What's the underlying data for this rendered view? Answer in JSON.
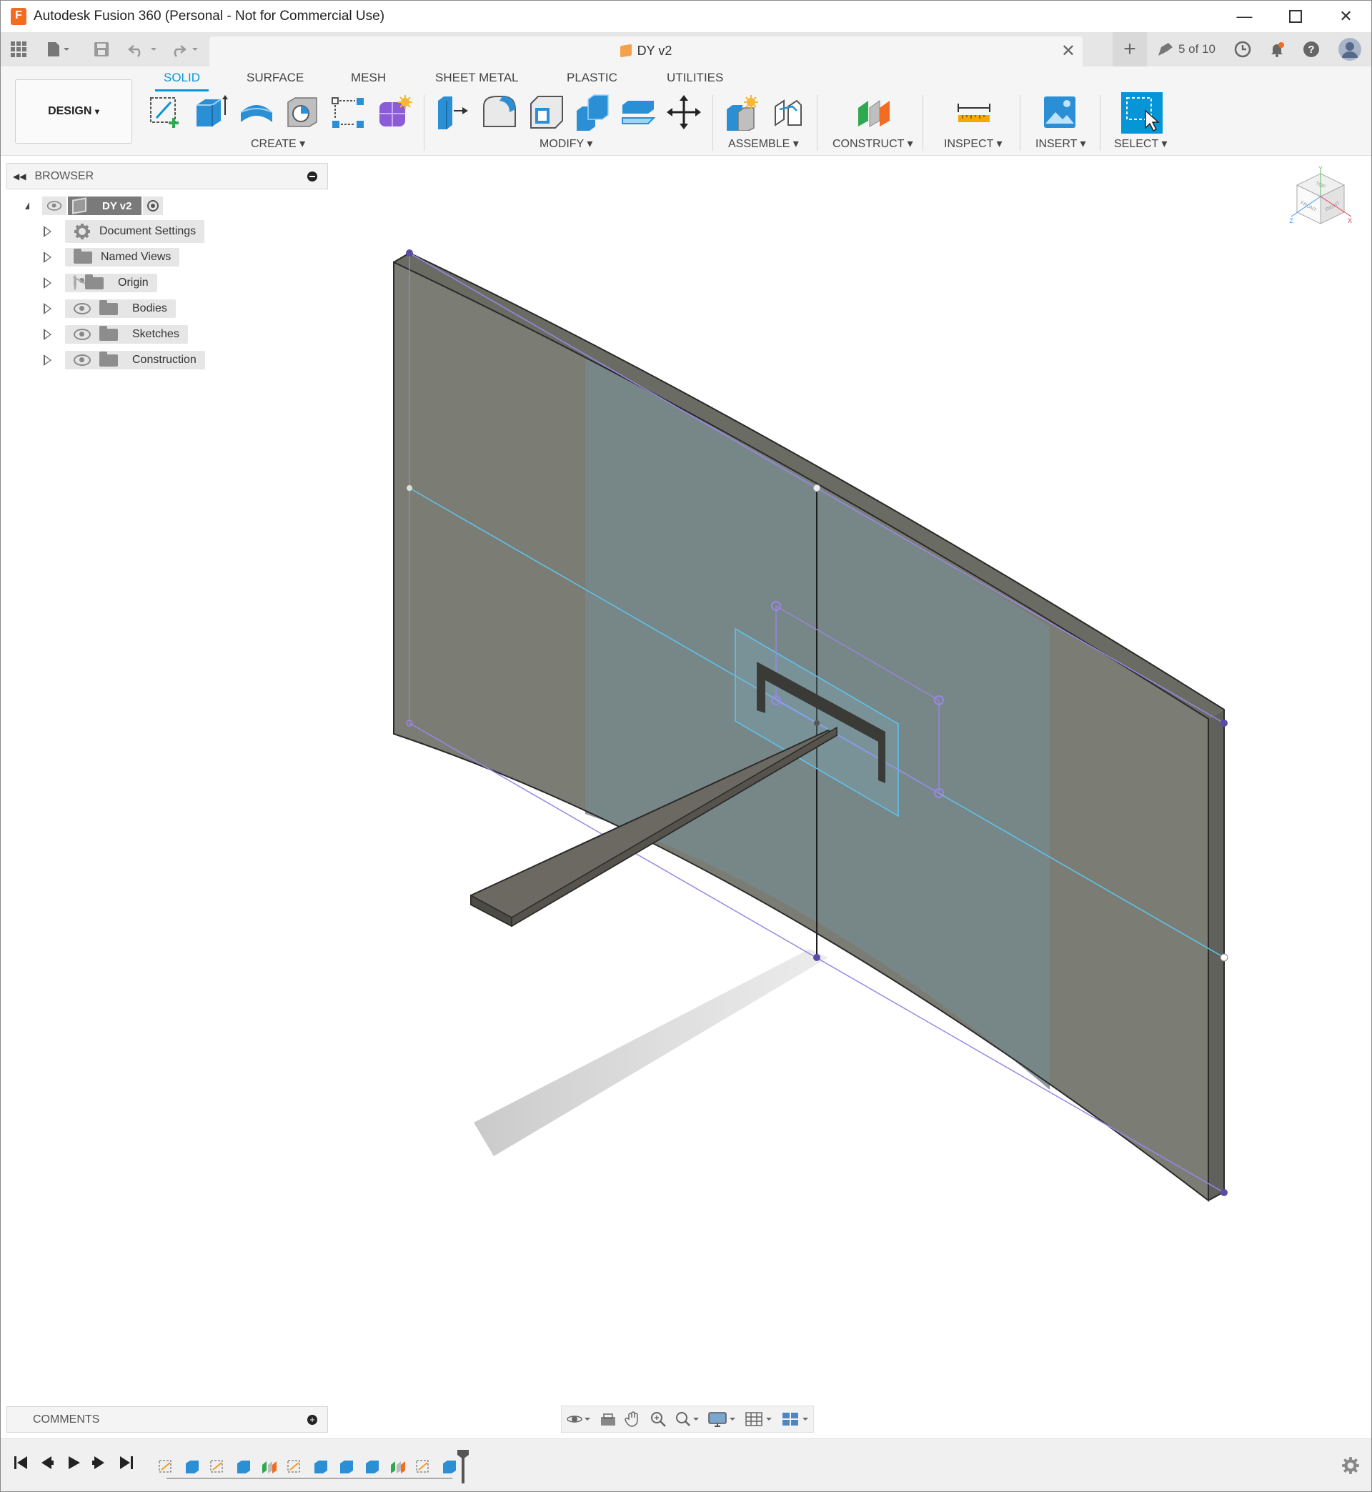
{
  "window": {
    "title": "Autodesk Fusion 360 (Personal - Not for Commercial Use)",
    "app_icon_letter": "F",
    "controls": [
      "minimize-icon",
      "maximize-icon",
      "close-icon"
    ]
  },
  "document_tab": {
    "title": "DY v2",
    "close": "✕"
  },
  "top_right": {
    "jobs_label": "5 of 10"
  },
  "workspace": {
    "label": "DESIGN",
    "caret": "▾"
  },
  "ribbon": {
    "tabs": [
      "SOLID",
      "SURFACE",
      "MESH",
      "SHEET METAL",
      "PLASTIC",
      "UTILITIES"
    ],
    "active_tab": "SOLID",
    "groups": {
      "create": "CREATE ▾",
      "modify": "MODIFY ▾",
      "assemble": "ASSEMBLE ▾",
      "construct": "CONSTRUCT ▾",
      "inspect": "INSPECT ▾",
      "insert": "INSERT ▾",
      "select": "SELECT ▾"
    }
  },
  "browser": {
    "title": "BROWSER",
    "root": "DY v2",
    "items": [
      {
        "label": "Document Settings",
        "icon": "gear-icon"
      },
      {
        "label": "Named Views",
        "icon": "folder-icon"
      },
      {
        "label": "Origin",
        "icon": "folder-icon",
        "hidden": true
      },
      {
        "label": "Bodies",
        "icon": "folder-icon"
      },
      {
        "label": "Sketches",
        "icon": "folder-icon"
      },
      {
        "label": "Construction",
        "icon": "folder-icon"
      }
    ]
  },
  "viewcube": {
    "faces": [
      "TOP",
      "FRONT",
      "RIGHT"
    ],
    "axes": [
      "X",
      "Y",
      "Z"
    ]
  },
  "comments": {
    "title": "COMMENTS"
  },
  "colors": {
    "accent": "#0696d7",
    "body_face": "#7b7d74",
    "sketch_line": "#5cc6f2",
    "constraint_line": "#9b86e6"
  }
}
